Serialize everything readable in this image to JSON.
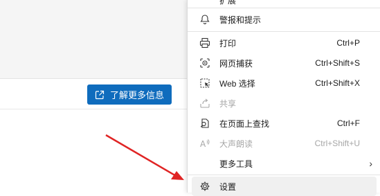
{
  "page": {
    "learn_more_label": "了解更多信息"
  },
  "menu": {
    "partial_top_label": "扩展",
    "items": [
      {
        "label": "警报和提示",
        "shortcut": ""
      },
      {
        "label": "打印",
        "shortcut": "Ctrl+P"
      },
      {
        "label": "网页捕获",
        "shortcut": "Ctrl+Shift+S"
      },
      {
        "label": "Web 选择",
        "shortcut": "Ctrl+Shift+X"
      },
      {
        "label": "共享",
        "shortcut": ""
      },
      {
        "label": "在页面上查找",
        "shortcut": "Ctrl+F"
      },
      {
        "label": "大声朗读",
        "shortcut": "Ctrl+Shift+U"
      },
      {
        "label": "更多工具",
        "shortcut": ""
      },
      {
        "label": "设置",
        "shortcut": ""
      }
    ],
    "more_tools_chevron": "›"
  },
  "colors": {
    "accent": "#0f6cbd",
    "arrow": "#e02424"
  }
}
